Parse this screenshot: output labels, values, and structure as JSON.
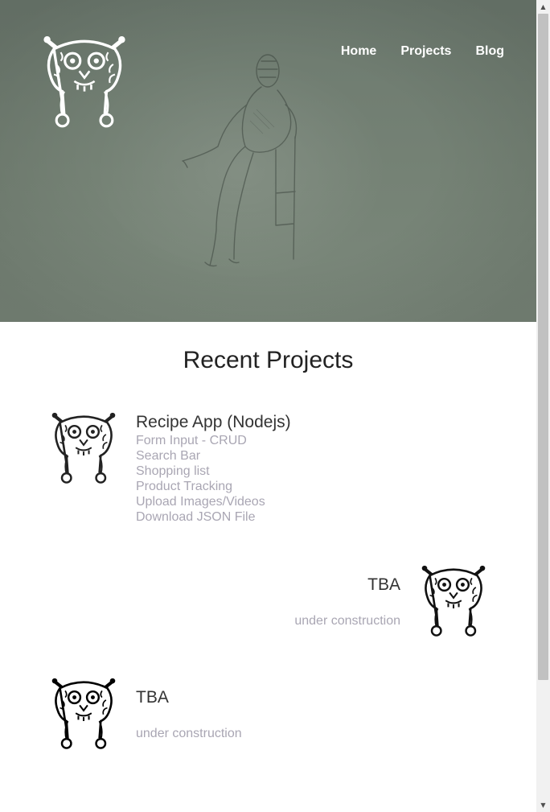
{
  "nav": {
    "items": [
      {
        "label": "Home"
      },
      {
        "label": "Projects"
      },
      {
        "label": "Blog"
      }
    ]
  },
  "main": {
    "section_title": "Recent Projects",
    "projects": [
      {
        "title": "Recipe App (Nodejs)",
        "features": [
          "Form Input - CRUD",
          "Search Bar",
          "Shopping list",
          "Product Tracking",
          "Upload Images/Videos",
          "Download JSON File"
        ],
        "icon": "octopus-mask-icon-outline"
      },
      {
        "title": "TBA",
        "description": "under construction",
        "icon": "octopus-mask-icon-half"
      },
      {
        "title": "TBA",
        "description": "under construction",
        "icon": "octopus-mask-icon-filled"
      }
    ]
  },
  "colors": {
    "hero_bg": "#737f73",
    "nav_text": "#ffffff",
    "title_text": "#222222",
    "muted_text": "#a9a6b3"
  }
}
